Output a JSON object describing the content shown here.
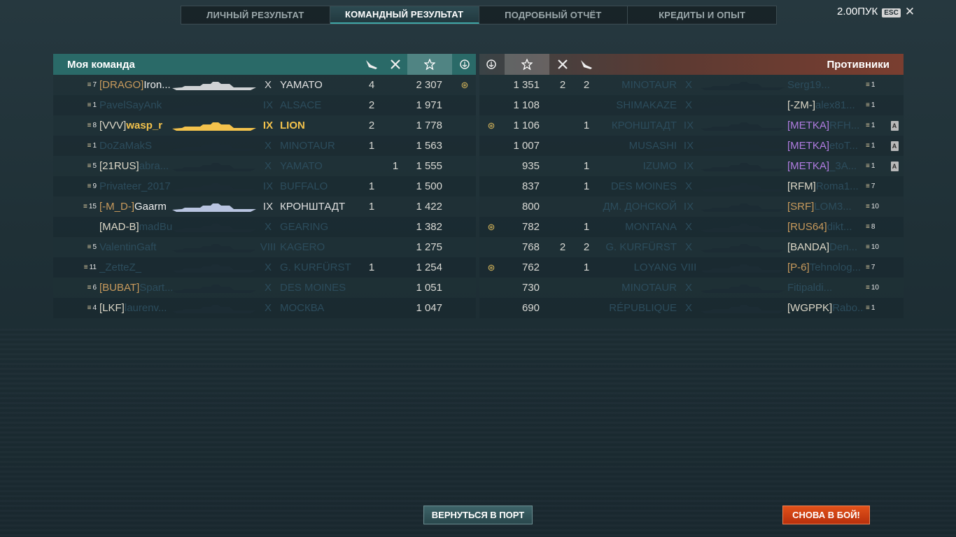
{
  "tabs": [
    {
      "label": "ЛИЧНЫЙ РЕЗУЛЬТАТ",
      "active": false
    },
    {
      "label": "КОМАНДНЫЙ РЕЗУЛЬТАТ",
      "active": true
    },
    {
      "label": "ПОДРОБНЫЙ ОТЧЁТ",
      "active": false
    },
    {
      "label": "КРЕДИТЫ И ОПЫТ",
      "active": false
    }
  ],
  "topright": {
    "points": "2.00ПУК",
    "esc": "ESC"
  },
  "my_team": {
    "title": "Моя команда",
    "columns": [
      "planes-icon",
      "kills-icon",
      "star-icon",
      "insignia-icon"
    ],
    "rows": [
      {
        "rank": "7",
        "clan": "[DRAGO]",
        "clan_color": "orange",
        "name": "Iron...",
        "tier": "X",
        "ship": "YAMATO",
        "planes": "4",
        "kills": "",
        "score": "2 307",
        "ins": true
      },
      {
        "rank": "1",
        "clan": "",
        "name": "PavelSayAnk",
        "name_dim": true,
        "tier": "IX",
        "ship": "ALSACE",
        "planes": "2",
        "kills": "",
        "score": "1 971",
        "ins": false,
        "dim": true
      },
      {
        "rank": "8",
        "clan": "[VVV]",
        "clan_color": "white",
        "name": "wasp_r",
        "me": true,
        "tier": "IX",
        "ship": "LION",
        "planes": "2",
        "kills": "",
        "score": "1 778",
        "ins": false
      },
      {
        "rank": "1",
        "clan": "",
        "name": "DoZaMakS",
        "name_dim": true,
        "tier": "X",
        "ship": "MINOTAUR",
        "planes": "1",
        "kills": "",
        "score": "1 563",
        "ins": false,
        "dim": true
      },
      {
        "rank": "5",
        "clan": "[21RUS]",
        "clan_color": "white",
        "name": "abra...",
        "name_dim": true,
        "tier": "X",
        "ship": "YAMATO",
        "planes": "",
        "kills": "1",
        "score": "1 555",
        "ins": false,
        "dim": true
      },
      {
        "rank": "9",
        "clan": "",
        "name": "Privateer_2017",
        "name_dim": true,
        "tier": "IX",
        "ship": "BUFFALO",
        "planes": "1",
        "kills": "",
        "score": "1 500",
        "ins": false,
        "dim": true
      },
      {
        "rank": "15",
        "clan": "[-M_D-]",
        "clan_color": "orange",
        "name": "Gaarm",
        "tier": "IX",
        "ship": "КРОНШТАДТ",
        "planes": "1",
        "kills": "",
        "score": "1 422",
        "ins": false
      },
      {
        "rank": "",
        "clan": "[MAD-B]",
        "clan_color": "white",
        "name": "madBuild...",
        "name_dim": true,
        "tier": "X",
        "ship": "GEARING",
        "planes": "",
        "kills": "",
        "score": "1 382",
        "ins": false,
        "dim": true
      },
      {
        "rank": "5",
        "clan": "",
        "name": "ValentinGaft",
        "name_dim": true,
        "tier": "VIII",
        "ship": "KAGERO",
        "planes": "",
        "kills": "",
        "score": "1 275",
        "ins": false,
        "dim": true
      },
      {
        "rank": "11",
        "clan": "",
        "name": "_ZetteZ_",
        "name_dim": true,
        "tier": "X",
        "ship": "G. KURFÜRST",
        "planes": "1",
        "kills": "",
        "score": "1 254",
        "ins": false,
        "dim": true
      },
      {
        "rank": "6",
        "clan": "[BUBAT]",
        "clan_color": "orange",
        "name": "Spart...",
        "name_dim": true,
        "tier": "X",
        "ship": "DES MOINES",
        "planes": "",
        "kills": "",
        "score": "1 051",
        "ins": false,
        "dim": true
      },
      {
        "rank": "4",
        "clan": "[LKF]",
        "clan_color": "white",
        "name": "laurenv...",
        "name_dim": true,
        "tier": "X",
        "ship": "МОСКВА",
        "planes": "",
        "kills": "",
        "score": "1 047",
        "ins": false,
        "dim": true
      }
    ]
  },
  "enemy_team": {
    "title": "Противники",
    "rows": [
      {
        "ins": false,
        "score": "1 351",
        "kills": "2",
        "planes": "2",
        "ship": "MINOTAUR",
        "tier": "X",
        "clan": "",
        "name": "Serg19...",
        "rank": "1",
        "badge": false,
        "dim": true
      },
      {
        "ins": false,
        "score": "1 108",
        "kills": "",
        "planes": "",
        "ship": "SHIMAKAZE",
        "tier": "X",
        "clan": "[-ZM-]",
        "clan_color": "white",
        "name": "alex81...",
        "rank": "1",
        "badge": false,
        "dim": true
      },
      {
        "ins": true,
        "score": "1 106",
        "kills": "",
        "planes": "1",
        "ship": "КРОНШТАДТ",
        "tier": "IX",
        "clan": "[METKA]",
        "clan_color": "purple",
        "name": "RFH...",
        "rank": "1",
        "badge": true,
        "dim": true
      },
      {
        "ins": false,
        "score": "1 007",
        "kills": "",
        "planes": "",
        "ship": "MUSASHI",
        "tier": "IX",
        "clan": "[METKA]",
        "clan_color": "purple",
        "name": "etoT...",
        "rank": "1",
        "badge": true,
        "dim": true
      },
      {
        "ins": false,
        "score": "935",
        "kills": "",
        "planes": "1",
        "ship": "IZUMO",
        "tier": "IX",
        "clan": "[METKA]",
        "clan_color": "purple",
        "name": "_3A...",
        "rank": "1",
        "badge": true,
        "dim": true
      },
      {
        "ins": false,
        "score": "837",
        "kills": "",
        "planes": "1",
        "ship": "DES MOINES",
        "tier": "X",
        "clan": "[RFM]",
        "clan_color": "white",
        "name": "Roma1...",
        "rank": "7",
        "badge": false,
        "dim": true
      },
      {
        "ins": false,
        "score": "800",
        "kills": "",
        "planes": "",
        "ship": "ДМ. ДОНСКОЙ",
        "tier": "IX",
        "clan": "[SRF]",
        "clan_color": "orange",
        "name": "LOM3...",
        "rank": "10",
        "badge": false,
        "dim": true
      },
      {
        "ins": true,
        "score": "782",
        "kills": "",
        "planes": "1",
        "ship": "MONTANA",
        "tier": "X",
        "clan": "[RUS64]",
        "clan_color": "orange",
        "name": "dikt...",
        "rank": "8",
        "badge": false,
        "dim": true
      },
      {
        "ins": false,
        "score": "768",
        "kills": "2",
        "planes": "2",
        "ship": "G. KURFÜRST",
        "tier": "X",
        "clan": "[BANDA]",
        "clan_color": "white",
        "name": "Den...",
        "rank": "10",
        "badge": false,
        "dim": true
      },
      {
        "ins": true,
        "score": "762",
        "kills": "",
        "planes": "1",
        "ship": "LOYANG",
        "tier": "VIII",
        "clan": "[P-6]",
        "clan_color": "orange",
        "name": "Tehnolog...",
        "rank": "7",
        "badge": false,
        "dim": true
      },
      {
        "ins": false,
        "score": "730",
        "kills": "",
        "planes": "",
        "ship": "MINOTAUR",
        "tier": "X",
        "clan": "",
        "name": "Fitipaldi...",
        "rank": "10",
        "badge": false,
        "dim": true
      },
      {
        "ins": false,
        "score": "690",
        "kills": "",
        "planes": "",
        "ship": "RÉPUBLIQUE",
        "tier": "X",
        "clan": "[WGPPK]",
        "clan_color": "white",
        "name": "Rabo...",
        "rank": "1",
        "badge": false,
        "dim": true
      }
    ]
  },
  "buttons": {
    "port": "ВЕРНУТЬСЯ В ПОРТ",
    "battle": "СНОВА В БОЙ!"
  },
  "colors": {
    "accent": "#3fa7a7",
    "my_header": "#2a6a68",
    "enemy_header": "#7a3e30",
    "self": "#f3c24c",
    "clan_orange": "#c89a5c",
    "clan_purple": "#b07ce0",
    "battle_button": "#d9421a"
  }
}
